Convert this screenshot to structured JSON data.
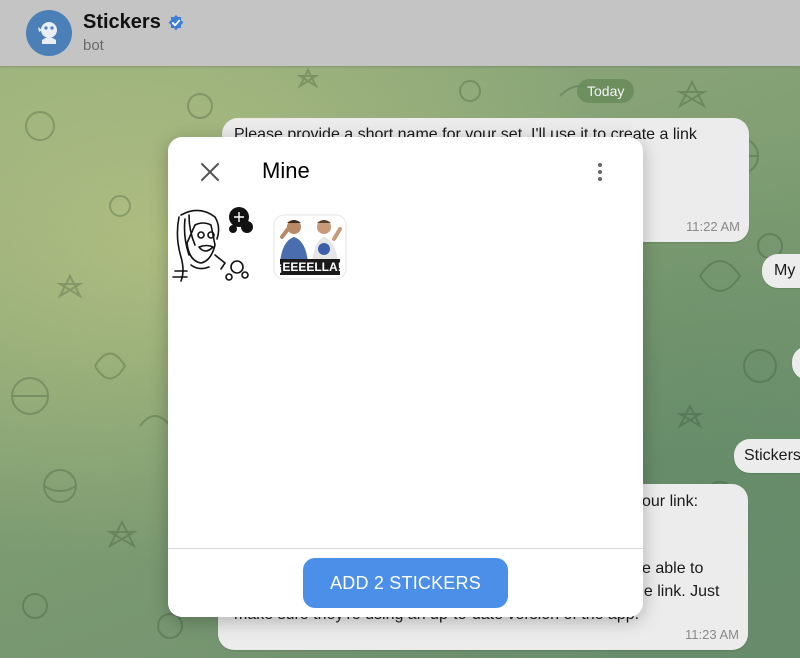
{
  "header": {
    "title": "Stickers",
    "subtitle": "bot",
    "avatar_icon": "bot-avatar-icon",
    "verified_icon": "verified-badge-icon"
  },
  "chat": {
    "date_label": "Today",
    "messages": [
      {
        "lines": [
          "Please provide a short name for your set. I'll use it to create a link"
        ],
        "time": "11:22 AM"
      },
      {
        "text": "My"
      },
      {
        "text": ""
      },
      {
        "text": "Stickers"
      },
      {
        "lines": [
          "our link:",
          "e able to",
          "ne link. Just",
          "make sure they're using an up-to-date version of the app."
        ],
        "time": "11:23 AM"
      }
    ]
  },
  "modal": {
    "title": "Mine",
    "close_icon": "close-icon",
    "menu_icon": "more-vertical-icon",
    "stickers": [
      {
        "name": "sticker-angry-girl"
      },
      {
        "name": "sticker-two-men",
        "caption": "¡EEEELLA!"
      }
    ],
    "add_button_label": "ADD 2 STICKERS",
    "accent": "#4c8fe8"
  }
}
